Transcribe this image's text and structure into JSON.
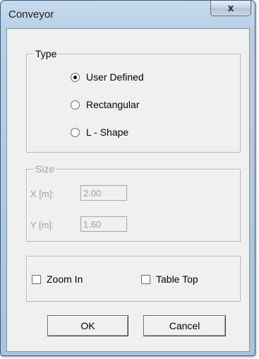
{
  "window": {
    "title": "Conveyor",
    "close_glyph": "x",
    "close_icon": "close-icon"
  },
  "type_group": {
    "legend": "Type",
    "options": [
      {
        "label": "User Defined",
        "checked": true
      },
      {
        "label": "Rectangular",
        "checked": false
      },
      {
        "label": "L - Shape",
        "checked": false
      }
    ]
  },
  "size_group": {
    "legend": "Size",
    "enabled": false,
    "x_label": "X [m]:",
    "x_value": "2.00",
    "y_label": "Y [m]:",
    "y_value": "1.60"
  },
  "options_group": {
    "zoom_in": {
      "label": "Zoom In",
      "checked": false
    },
    "table_top": {
      "label": "Table Top",
      "checked": false
    }
  },
  "buttons": {
    "ok": "OK",
    "cancel": "Cancel"
  }
}
